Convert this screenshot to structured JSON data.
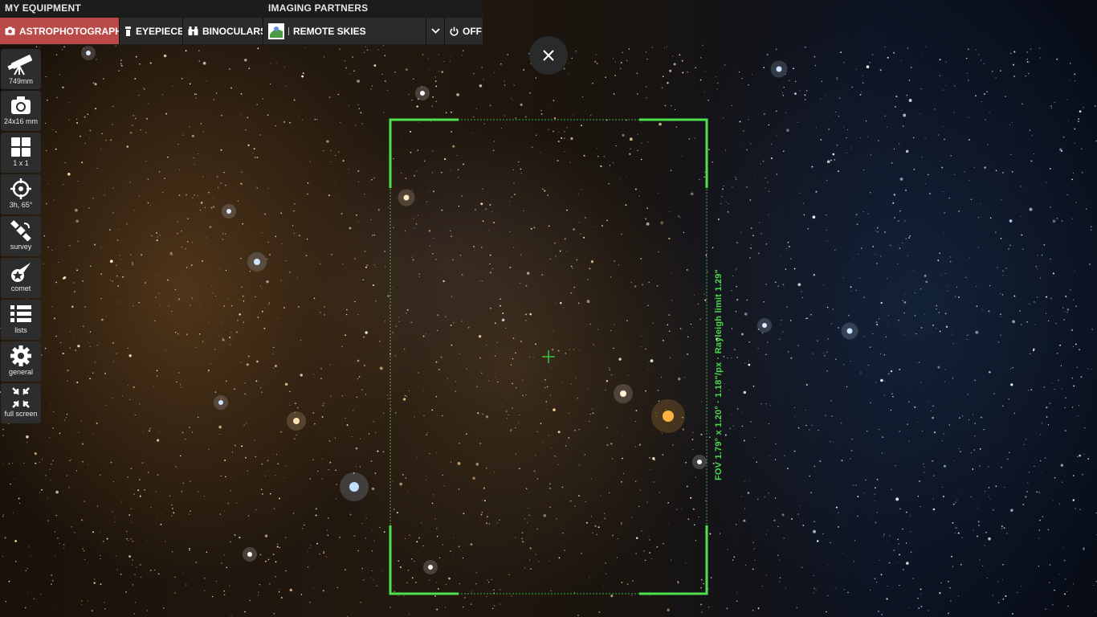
{
  "topbar": {
    "my_equipment_label": "MY EQUIPMENT",
    "imaging_partners_label": "IMAGING PARTNERS",
    "astrophotography_label": "ASTROPHOTOGRAPHY",
    "eyepiece_label": "EYEPIECE",
    "binoculars_label": "BINOCULARS",
    "remote_skies_label": "REMOTE SKIES",
    "off_label": "OFF"
  },
  "sidebar": {
    "items": [
      {
        "icon": "telescope-icon",
        "label": "749mm"
      },
      {
        "icon": "camera-icon",
        "label": "24x16 mm"
      },
      {
        "icon": "mosaic-grid-icon",
        "label": "1 x 1"
      },
      {
        "icon": "crosshair-icon",
        "label": "3h, 65°"
      },
      {
        "icon": "satellite-icon",
        "label": "survey"
      },
      {
        "icon": "comet-icon",
        "label": "comet"
      },
      {
        "icon": "list-icon",
        "label": "lists"
      },
      {
        "icon": "gear-icon",
        "label": "general"
      },
      {
        "icon": "fullscreen-icon",
        "label": "full screen"
      }
    ]
  },
  "fov": {
    "info": "FOV 1.79° x 1.20° · 1.18\"/px · Rayleigh limit 1.29\""
  },
  "colors": {
    "active_tab": "#b94a48",
    "fov_frame": "#49d94b",
    "toolbar_bg": "#2b2b2b"
  }
}
